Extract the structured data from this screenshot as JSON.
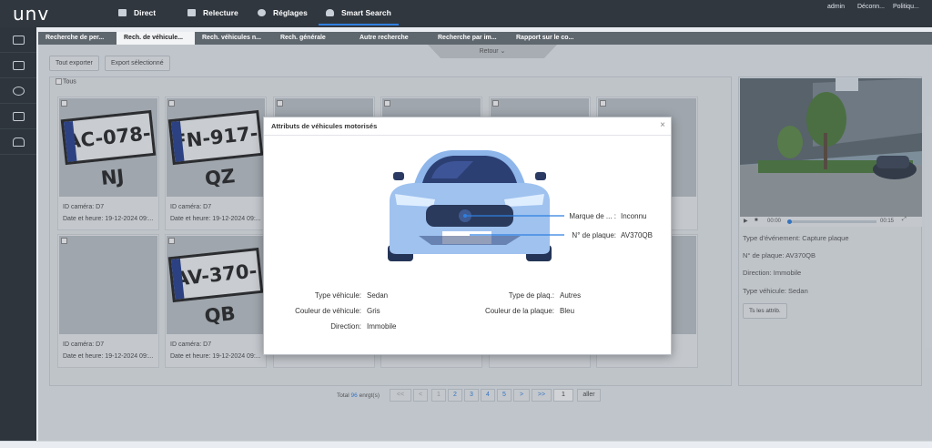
{
  "brand": {
    "logo": "unv"
  },
  "topnav": [
    {
      "label": "Direct",
      "icon": "monitor-icon"
    },
    {
      "label": "Relecture",
      "icon": "film-icon"
    },
    {
      "label": "Réglages",
      "icon": "gear-icon"
    },
    {
      "label": "Smart Search",
      "icon": "person-search-icon",
      "active": true
    }
  ],
  "topright": {
    "user": "admin",
    "logout": "Déconn...",
    "policy": "Politiqu..."
  },
  "leftnav": [
    "camera-search-icon",
    "face-card-icon",
    "gauge-icon",
    "screen-search-icon",
    "car-icon"
  ],
  "tabs": [
    "Recherche de per...",
    "Rech. de véhicule...",
    "Rech. véhicules n...",
    "Rech. générale",
    "Autre recherche",
    "Recherche par im...",
    "Rapport sur le co..."
  ],
  "active_tab": 1,
  "retour": "Retour",
  "toolbar": {
    "export_all": "Tout exporter",
    "export_selected": "Export sélectionné"
  },
  "select_all": "Tous",
  "cards": [
    {
      "plate": "AC-078-NJ",
      "camera": "ID caméra: D7",
      "date": "Date et heure: 19-12-2024 09:..."
    },
    {
      "plate": "FN-917-QZ",
      "camera": "ID caméra: D7",
      "date": "Date et heure: 19-12-2024 09:..."
    },
    {
      "plate": "",
      "camera": "",
      "date": ""
    },
    {
      "plate": "",
      "camera": "",
      "date": ""
    },
    {
      "plate": "",
      "camera": "",
      "date": ""
    },
    {
      "plate": "",
      "camera": "",
      "date": "24 09:..."
    },
    {
      "plate": "",
      "camera": "ID caméra: D7",
      "date": "Date et heure: 19-12-2024 09:..."
    },
    {
      "plate": "AV-370-QB",
      "camera": "ID caméra: D7",
      "date": "Date et heure: 19-12-2024 09:..."
    },
    {
      "plate": "",
      "camera": "",
      "date": ""
    },
    {
      "plate": "",
      "camera": "",
      "date": ""
    },
    {
      "plate": "",
      "camera": "",
      "date": ""
    },
    {
      "plate": "",
      "camera": "",
      "date": ""
    }
  ],
  "video": {
    "time_start": "00:00",
    "time_end": "00:15"
  },
  "details": {
    "event_type": {
      "label": "Type d'événement:",
      "value": "Capture plaque"
    },
    "plate": {
      "label": "N° de plaque:",
      "value": "AV370QB"
    },
    "direction": {
      "label": "Direction:",
      "value": "Immobile"
    },
    "vehicle_type": {
      "label": "Type véhicule:",
      "value": "Sedan"
    },
    "all_attrib_button": "Ts les attrib."
  },
  "pager": {
    "total_prefix": "Total",
    "total": "96",
    "total_suffix": "enrgt(s)",
    "first": "<<",
    "prev": "<",
    "pages": [
      "1",
      "2",
      "3",
      "4",
      "5"
    ],
    "current_page": 1,
    "next": ">",
    "last": ">>",
    "goto_value": "1",
    "goto_button": "aller"
  },
  "modal": {
    "title": "Attributs de véhicules motorisés",
    "close": "×",
    "brand": {
      "label": "Marque de ... :",
      "value": "Inconnu"
    },
    "plate": {
      "label": "N° de plaque:",
      "value": "AV370QB"
    },
    "vehicle_type": {
      "label": "Type véhicule:",
      "value": "Sedan"
    },
    "vehicle_color": {
      "label": "Couleur de véhicule:",
      "value": "Gris"
    },
    "direction": {
      "label": "Direction:",
      "value": "Immobile"
    },
    "plate_type": {
      "label": "Type de plaq.:",
      "value": "Autres"
    },
    "plate_color": {
      "label": "Couleur de la plaque:",
      "value": "Bleu"
    }
  },
  "colors": {
    "accent": "#2f7fe0",
    "topbar": "#30373f",
    "car_body": "#9fc2ef",
    "car_dark": "#2a3a5c"
  }
}
